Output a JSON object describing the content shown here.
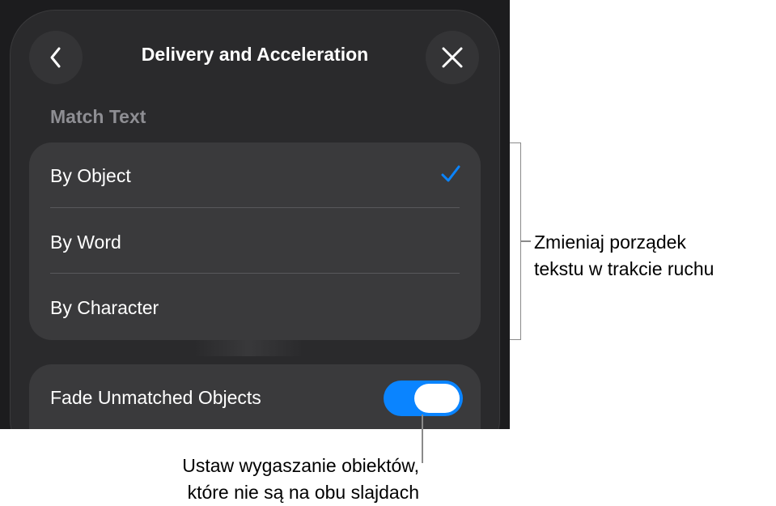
{
  "nav": {
    "title": "Delivery and Acceleration",
    "back_icon": "chevron-left-icon",
    "close_icon": "close-icon"
  },
  "match_text": {
    "section_label": "Match Text",
    "options": [
      {
        "label": "By Object",
        "selected": true
      },
      {
        "label": "By Word",
        "selected": false
      },
      {
        "label": "By Character",
        "selected": false
      }
    ],
    "check_icon": "checkmark-icon"
  },
  "fade": {
    "label": "Fade Unmatched Objects",
    "toggle_on": true
  },
  "colors": {
    "accent": "#0a84ff",
    "background": "#1c1c1e",
    "panel": "#2a2a2c",
    "group": "#3a3a3c"
  },
  "callouts": {
    "right": [
      "Zmieniaj porządek",
      "tekstu w trakcie ruchu"
    ],
    "bottom": [
      "Ustaw wygaszanie obiektów,",
      "które nie są na obu slajdach"
    ]
  }
}
